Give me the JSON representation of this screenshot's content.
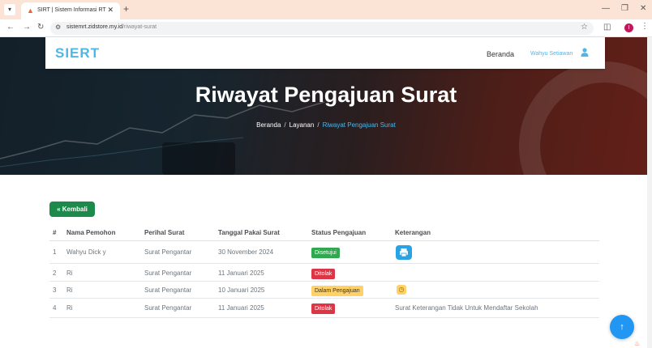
{
  "browser": {
    "tab_title": "SIRT | Sistem Informasi RT",
    "url_host": "sistemrt.zidstore.my.id",
    "url_path": "/riwayat-surat",
    "profile_initial": "I"
  },
  "navbar": {
    "logo": "SIERT",
    "home": "Beranda",
    "user": "Wahyu Setiawan"
  },
  "hero": {
    "title": "Riwayat Pengajuan Surat",
    "breadcrumb": [
      "Beranda",
      "Layanan",
      "Riwayat Pengajuan Surat"
    ]
  },
  "back_button": "« Kembali",
  "table": {
    "headers": [
      "#",
      "Nama Pemohon",
      "Perihal Surat",
      "Tanggal Pakai Surat",
      "Status Pengajuan",
      "Keterangan"
    ],
    "rows": [
      {
        "no": "1",
        "nama": "Wahyu Dick y",
        "perihal": "Surat Pengantar",
        "tanggal": "30 November 2024",
        "status": "Disetujui",
        "status_type": "success",
        "keterangan": "",
        "action": "print"
      },
      {
        "no": "2",
        "nama": "Ri",
        "perihal": "Surat Pengantar",
        "tanggal": "11 Januari 2025",
        "status": "Ditolak",
        "status_type": "danger",
        "keterangan": "",
        "action": ""
      },
      {
        "no": "3",
        "nama": "Ri",
        "perihal": "Surat Pengantar",
        "tanggal": "10 Januari 2025",
        "status": "Dalam Pengajuan",
        "status_type": "warning",
        "keterangan": "",
        "action": "clock"
      },
      {
        "no": "4",
        "nama": "Ri",
        "perihal": "Surat Pengantar",
        "tanggal": "11 Januari 2025",
        "status": "Ditolak",
        "status_type": "danger",
        "keterangan": "Surat Keterangan Tidak Untuk Mendaftar Sekolah",
        "action": ""
      }
    ]
  },
  "colors": {
    "accent": "#4fb6e8",
    "success": "#2fa84f",
    "danger": "#dc3545",
    "warning": "#ffd166",
    "back_button": "#1b8a4a",
    "fab": "#2196f3"
  },
  "icons": {
    "print": "print-icon",
    "clock": "clock-icon",
    "user": "user-icon",
    "scroll_top": "arrow-up-icon"
  }
}
